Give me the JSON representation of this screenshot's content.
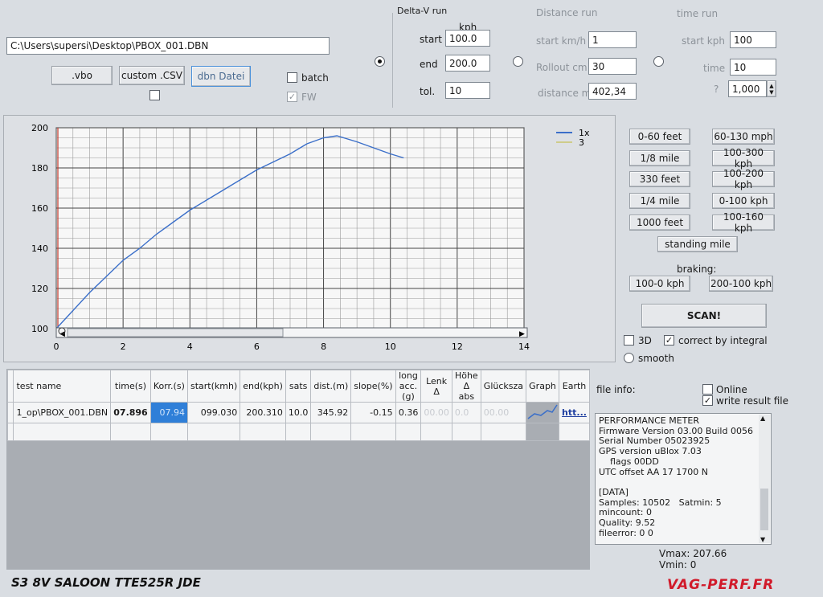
{
  "file_path": "C:\\Users\\supersi\\Desktop\\PBOX_001.DBN",
  "buttons": {
    "vbo": ".vbo",
    "csv": "custom .CSV",
    "dbn": "dbn Datei"
  },
  "checks": {
    "batch": "batch",
    "fw": "FW"
  },
  "delta_v": {
    "title": "Delta-V run",
    "unit": "kph",
    "start_label": "start",
    "start_value": "100.0",
    "end_label": "end",
    "end_value": "200.0",
    "tol_label": "tol.",
    "tol_value": "10"
  },
  "distance_run": {
    "title": "Distance run",
    "start_label": "start km/h",
    "start_value": "1",
    "rollout_label": "Rollout cm",
    "rollout_value": "30",
    "distance_label": "distance m",
    "distance_value": "402,34"
  },
  "time_run": {
    "title": "time run",
    "start_label": "start kph",
    "start_value": "100",
    "time_label": "time",
    "time_value": "10",
    "q_label": "?",
    "q_value": "1,000"
  },
  "preset_buttons": {
    "b1": "0-60 feet",
    "b2": "60-130 mph",
    "b3": "1/8 mile",
    "b4": "100-300 kph",
    "b5": "330 feet",
    "b6": "100-200 kph",
    "b7": "1/4 mile",
    "b8": "0-100 kph",
    "b9": "1000 feet",
    "b10": "100-160 kph",
    "b11": "standing mile",
    "braking_label": "braking:",
    "b12": "100-0 kph",
    "b13": "200-100 kph",
    "scan": "SCAN!"
  },
  "options": {
    "d3": "3D",
    "correct": "correct by integral",
    "smooth": "smooth"
  },
  "chart_data": {
    "type": "line",
    "xlim": [
      0,
      14
    ],
    "ylim": [
      100,
      200
    ],
    "x_ticks": [
      "0",
      "2",
      "4",
      "6",
      "8",
      "10",
      "12",
      "14"
    ],
    "y_ticks": [
      "100",
      "120",
      "140",
      "160",
      "180",
      "200"
    ],
    "grid": true,
    "legend": "top-right",
    "legend_entries": [
      "1x",
      "3"
    ],
    "series": [
      {
        "name": "1x",
        "color": "#3b6fc9",
        "x": [
          0,
          0.5,
          1,
          1.5,
          2,
          2.5,
          3,
          3.5,
          4,
          4.5,
          5,
          5.5,
          6,
          6.5,
          7,
          7.5,
          8,
          8.4,
          9,
          9.5,
          10,
          10.4
        ],
        "y": [
          100,
          109,
          118,
          126,
          134,
          140,
          147,
          153,
          159,
          164,
          169,
          174,
          179,
          183,
          187,
          192,
          195,
          196,
          193,
          190,
          187,
          185
        ]
      }
    ]
  },
  "table": {
    "headers": [
      "test name",
      "time(s)",
      "Korr.(s)",
      "start(kmh)",
      "end(kph)",
      "sats",
      "dist.(m)",
      "slope(%)",
      "long acc.(g)",
      "Lenk Δ",
      "Höhe Δ abs",
      "Glücksza",
      "Graph",
      "Earth"
    ],
    "row": [
      "1_op\\PBOX_001.DBN",
      "07.896",
      "07.94",
      "099.030",
      "200.310",
      "10.0",
      "345.92",
      "-0.15",
      "0.36",
      "00.00",
      "0.0",
      "00.00",
      "",
      "htt..."
    ]
  },
  "file_info": {
    "label": "file info:",
    "online": "Online",
    "write": "write result file",
    "lines": [
      "PERFORMANCE METER",
      "Firmware Version 03.00 Build 0056",
      "Serial Number 05023925",
      "GPS version uBlox 7.03",
      "    flags 00DD",
      "UTC offset AA 17 1700 N",
      "",
      "[DATA]",
      "Samples: 10502   Satmin: 5",
      "mincount: 0",
      "Quality: 9.52",
      "fileerror: 0 0"
    ],
    "vmax": "Vmax: 207.66",
    "vmin": "Vmin: 0"
  },
  "caption": "S3 8V SALOON TTE525R JDE",
  "watermark": "VAG-PERF.FR",
  "colors": {
    "accent": "#3b6fc9",
    "highlight": "#2f7fd8",
    "grid_red": "#c0392b",
    "watermark": "#d11a2a"
  }
}
